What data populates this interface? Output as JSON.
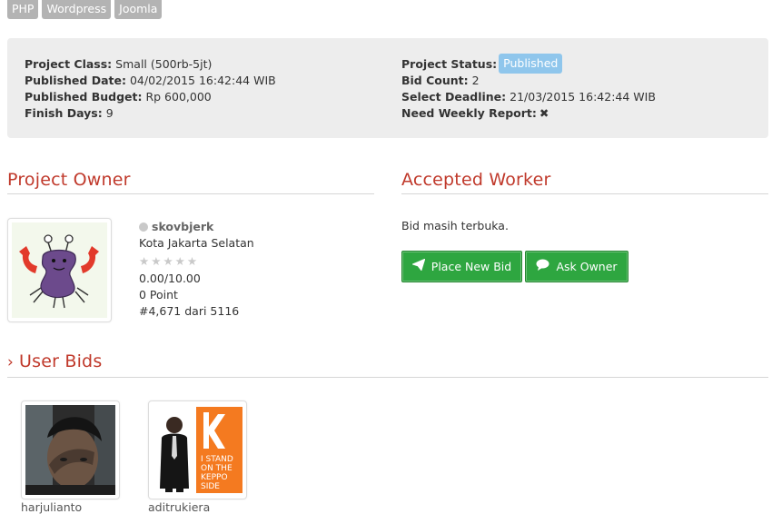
{
  "tags": [
    "PHP",
    "Wordpress",
    "Joomla"
  ],
  "info": {
    "left": [
      {
        "label": "Project Class:",
        "value": "Small (500rb-5jt)"
      },
      {
        "label": "Published Date:",
        "value": "04/02/2015 16:42:44 WIB"
      },
      {
        "label": "Published Budget:",
        "value": "Rp 600,000"
      },
      {
        "label": "Finish Days:",
        "value": "9"
      }
    ],
    "right": [
      {
        "label": "Project Status:",
        "value": "Published"
      },
      {
        "label": "Bid Count:",
        "value": "2"
      },
      {
        "label": "Select Deadline:",
        "value": "21/03/2015 16:42:44 WIB"
      },
      {
        "label": "Need Weekly Report:",
        "value": "✖"
      }
    ]
  },
  "owner": {
    "heading": "Project Owner",
    "username": "skovbjerk",
    "location": "Kota Jakarta Selatan",
    "rating_text": "0.00/10.00",
    "stars_filled": 0,
    "stars_total": 5,
    "points": "0 Point",
    "rank": "#4,671 dari 5116"
  },
  "worker": {
    "heading": "Accepted Worker",
    "status_text": "Bid masih terbuka.",
    "place_bid_label": "Place New Bid",
    "ask_owner_label": "Ask Owner"
  },
  "bids": {
    "heading": "User Bids",
    "users": [
      {
        "name": "harjulianto"
      },
      {
        "name": "aditrukiera",
        "sign_text": [
          "I STAND",
          "ON THE",
          "KEPPO",
          "SIDE"
        ]
      }
    ]
  },
  "colors": {
    "accent": "#c0392b",
    "button": "#2ea640",
    "badge": "#8fc6ec",
    "panel": "#ededed"
  },
  "icons": {
    "place_bid": "paper-plane-icon",
    "ask_owner": "chat-bubble-icon",
    "section_chevron": "chevron-right-icon"
  }
}
